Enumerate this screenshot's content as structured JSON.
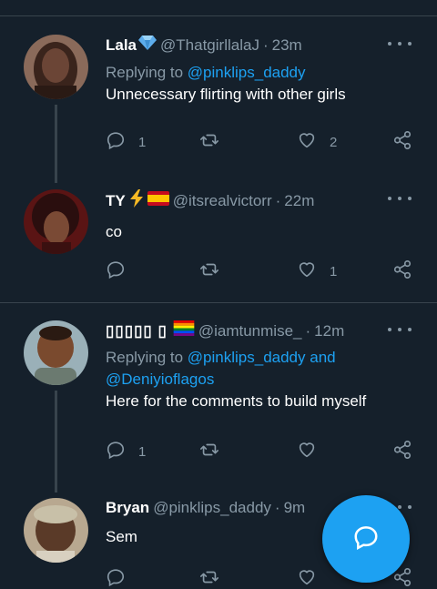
{
  "colors": {
    "background": "#15202b",
    "accent": "#1da1f2",
    "muted": "#8899a6",
    "divider": "#38444d"
  },
  "tweets": [
    {
      "name": "Lala",
      "name_emoji": "gem-icon",
      "handle": "@ThatgirllalaJ",
      "time": "23m",
      "reply_prefix": "Replying to ",
      "reply_link_1": "@pinklips_daddy",
      "text": "Unnecessary flirting with other girls",
      "reply_count": "1",
      "like_count": "2"
    },
    {
      "name": "TY",
      "name_emoji": "lightning-spain-flag-icons",
      "handle": "@itsrealvictorr",
      "time": "22m",
      "text": "co",
      "reply_count": "",
      "like_count": "1"
    },
    {
      "name": "▯▯▯▯▯ ▯",
      "name_emoji": "rainbow-flag-icon",
      "handle": "@iamtunmise_",
      "time": "12m",
      "reply_prefix": "Replying to ",
      "reply_link_1": "@pinklips_daddy",
      "reply_and": " and",
      "reply_link_2": "@Deniyioflagos",
      "text": "Here for the comments to build myself",
      "reply_count": "1",
      "like_count": ""
    },
    {
      "name": "Bryan",
      "handle": "@pinklips_daddy",
      "time": "9m",
      "text": "Sem",
      "reply_count": "",
      "like_count": ""
    }
  ],
  "separator": "·",
  "fab": {
    "icon": "compose-reply-icon"
  }
}
